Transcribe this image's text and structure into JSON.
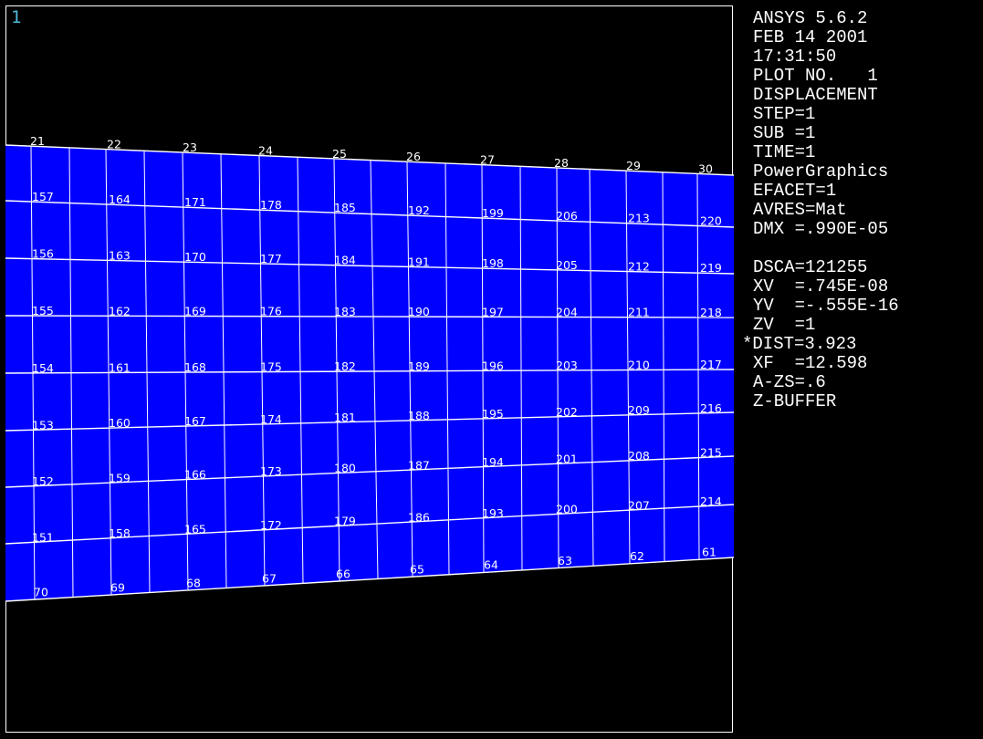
{
  "window": {
    "number": "1"
  },
  "legend": [
    "ANSYS 5.6.2",
    "FEB 14 2001",
    "17:31:50",
    "PLOT NO.   1",
    "DISPLACEMENT",
    "STEP=1",
    "SUB =1",
    "TIME=1",
    "PowerGraphics",
    "EFACET=1",
    "AVRES=Mat",
    "DMX =.990E-05",
    "",
    "DSCA=121255",
    "XV  =.745E-08",
    "YV  =-.555E-16",
    "ZV  =1",
    "*DIST=3.923",
    "XF  =12.598",
    "A-ZS=.6",
    "Z-BUFFER"
  ],
  "colors": {
    "background": "#000000",
    "mesh_fill": "#0000ff",
    "mesh_lines": "#ffffff",
    "frame": "#ffffff",
    "window_number": "#4fb8d8"
  },
  "mesh": {
    "column_labels": [
      "21",
      "22",
      "23",
      "24",
      "25",
      "26",
      "27",
      "28",
      "29",
      "30"
    ],
    "row_labels": [
      [
        "157",
        "164",
        "171",
        "178",
        "185",
        "192",
        "199",
        "206",
        "213",
        "220"
      ],
      [
        "156",
        "163",
        "170",
        "177",
        "184",
        "191",
        "198",
        "205",
        "212",
        "219"
      ],
      [
        "155",
        "162",
        "169",
        "176",
        "183",
        "190",
        "197",
        "204",
        "211",
        "218"
      ],
      [
        "154",
        "161",
        "168",
        "175",
        "182",
        "189",
        "196",
        "203",
        "210",
        "217"
      ],
      [
        "153",
        "160",
        "167",
        "174",
        "181",
        "188",
        "195",
        "202",
        "209",
        "216"
      ],
      [
        "152",
        "159",
        "166",
        "173",
        "180",
        "187",
        "194",
        "201",
        "208",
        "215"
      ],
      [
        "151",
        "158",
        "165",
        "172",
        "179",
        "186",
        "193",
        "200",
        "207",
        "214"
      ]
    ],
    "bottom_labels": [
      "70",
      "69",
      "68",
      "67",
      "66",
      "65",
      "64",
      "63",
      "62",
      "61"
    ]
  }
}
